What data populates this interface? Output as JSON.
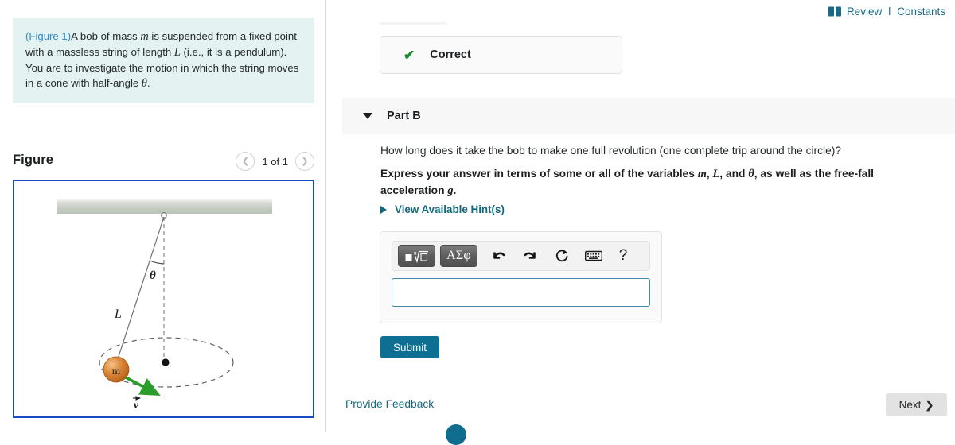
{
  "header": {
    "book_icon": "book-icon",
    "review_label": "Review",
    "separator": "l",
    "constants_label": "Constants"
  },
  "left_panel": {
    "problem": {
      "figure_link": "(Figure 1)",
      "text_part_1": "A bob of mass ",
      "var_m": "m",
      "text_part_2": " is suspended from a fixed point with a massless string of length ",
      "var_L": "L",
      "text_part_3": " (i.e., it is a pendulum). You are to investigate the motion in which the string moves in a cone with half-angle ",
      "var_theta": "θ",
      "text_part_4": "."
    },
    "figure": {
      "title": "Figure",
      "prev_icon": "chevron-left-icon",
      "next_icon": "chevron-right-icon",
      "pager_label": "1 of 1",
      "diagram": {
        "ceiling_label": "",
        "angle_label": "θ",
        "length_label": "L",
        "mass_label": "m",
        "velocity_label": "v⃗"
      }
    }
  },
  "right_panel": {
    "feedback_banner": {
      "check_icon": "check-icon",
      "label": "Correct"
    },
    "part": {
      "collapse_icon": "caret-down-icon",
      "label": "Part B"
    },
    "question": "How long does it take the bob to make one full revolution (one complete trip around the circle)?",
    "instruction": {
      "text_1": "Express your answer in terms of some or all of the variables ",
      "var_m": "m",
      "sep_1": ", ",
      "var_L": "L",
      "sep_2": ", and ",
      "var_theta": "θ",
      "text_2": ", as well as the free-fall acceleration ",
      "var_g": "g",
      "text_3": "."
    },
    "hints": {
      "expand_icon": "caret-right-icon",
      "label": "View Available Hint(s)"
    },
    "answer_toolbar": {
      "template_button": "template-math-icon",
      "greek_button": "ΑΣφ",
      "undo_button": "undo-icon",
      "redo_button": "redo-icon",
      "reset_button": "reset-icon",
      "keyboard_button": "keyboard-icon",
      "help_button": "?"
    },
    "answer_input": {
      "value": "",
      "placeholder": ""
    },
    "submit_label": "Submit",
    "feedback_label": "Provide Feedback",
    "next_label": "Next",
    "next_icon": "chevron-right-icon"
  },
  "colors": {
    "accent_teal": "#0d7093",
    "link_teal": "#12697f",
    "problem_bg": "#e4f2f2",
    "figure_border": "#1a49c9",
    "correct_green": "#128a2e",
    "bob_orange": "#d2762c",
    "velocity_green": "#2a9d2a"
  }
}
